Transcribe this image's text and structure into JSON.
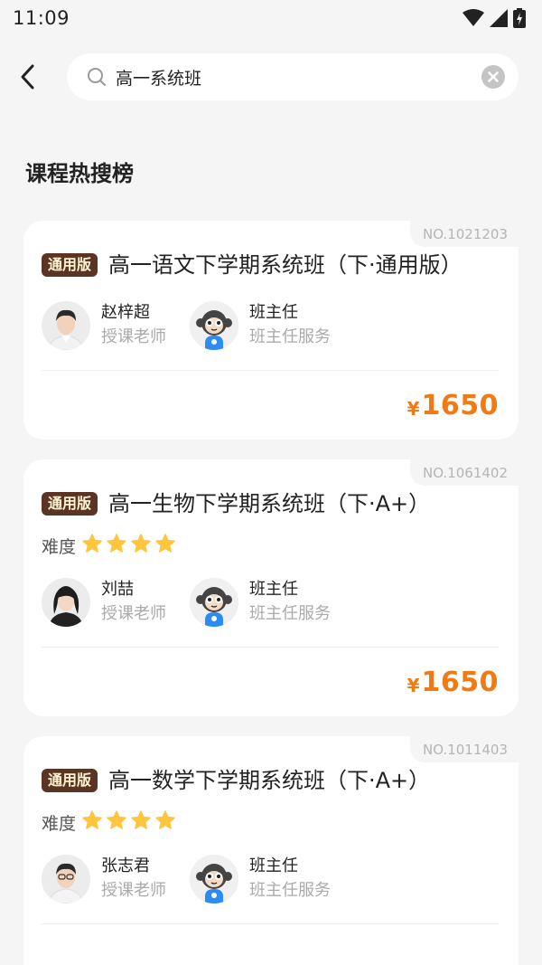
{
  "status": {
    "time": "11:09"
  },
  "search": {
    "query": "高一系统班"
  },
  "section": {
    "title": "课程热搜榜"
  },
  "courses": [
    {
      "no": "NO.1021203",
      "badge": "通用版",
      "title": "高一语文下学期系统班（下·通用版）",
      "difficulty_label": "",
      "stars": 0,
      "teacher": {
        "name": "赵梓超",
        "role": "授课老师"
      },
      "head": {
        "name": "班主任",
        "role": "班主任服务"
      },
      "yen": "¥",
      "price": "1650"
    },
    {
      "no": "NO.1061402",
      "badge": "通用版",
      "title": "高一生物下学期系统班（下·A+）",
      "difficulty_label": "难度",
      "stars": 4,
      "teacher": {
        "name": "刘喆",
        "role": "授课老师"
      },
      "head": {
        "name": "班主任",
        "role": "班主任服务"
      },
      "yen": "¥",
      "price": "1650"
    },
    {
      "no": "NO.1011403",
      "badge": "通用版",
      "title": "高一数学下学期系统班（下·A+）",
      "difficulty_label": "难度",
      "stars": 4,
      "teacher": {
        "name": "张志君",
        "role": "授课老师"
      },
      "head": {
        "name": "班主任",
        "role": "班主任服务"
      },
      "yen": "",
      "price": ""
    }
  ],
  "colors": {
    "accent": "#f07a14",
    "badge_bg": "#5a3526",
    "star": "#ffc53d",
    "mascot_blue": "#2b8cf5"
  }
}
